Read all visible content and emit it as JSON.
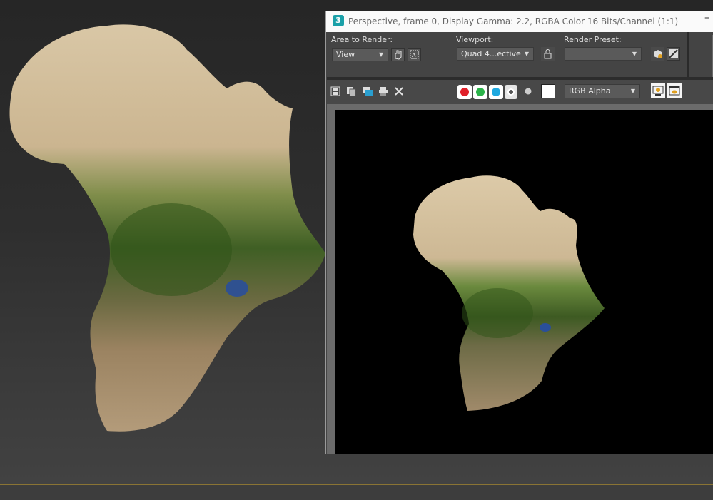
{
  "window": {
    "title": "Perspective, frame 0, Display Gamma: 2.2, RGBA Color 16 Bits/Channel (1:1)",
    "app_icon": "3",
    "minimize_glyph": "–"
  },
  "controls": {
    "area_to_render": {
      "label": "Area to Render:",
      "value": "View"
    },
    "viewport": {
      "label": "Viewport:",
      "value": "Quad 4...ective"
    },
    "render_preset": {
      "label": "Render Preset:",
      "value": ""
    }
  },
  "toolbar": {
    "channel_display": "RGB Alpha",
    "channel_colors": {
      "red": "#e0202a",
      "green": "#2bb34a",
      "blue": "#1fa9e0"
    }
  },
  "icons": [
    "save-icon",
    "copy-icon",
    "clone-window-icon",
    "print-icon",
    "clear-icon",
    "red-channel-icon",
    "green-channel-icon",
    "blue-channel-icon",
    "alpha-channel-icon",
    "monochrome-icon",
    "color-swatch-icon",
    "display-toggle-icon",
    "image-display-icon",
    "pan-icon",
    "auto-region-icon",
    "lock-icon",
    "render-setup-icon",
    "environment-icon"
  ],
  "colors": {
    "viewport_bg": "#2e2e2e",
    "grid_line": "#8a7434",
    "vfb_panel": "#444444",
    "render_bg": "#000000"
  }
}
